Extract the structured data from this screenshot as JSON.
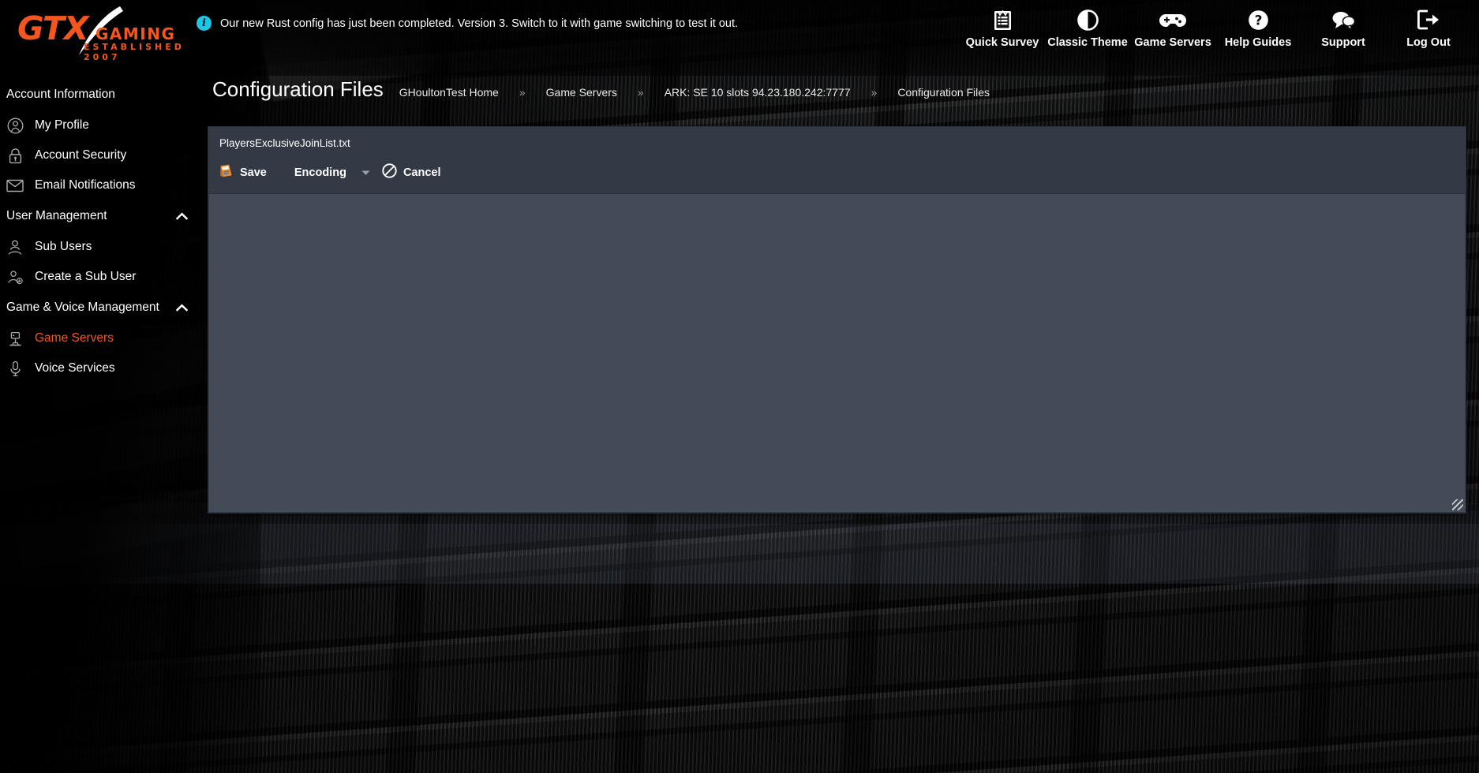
{
  "brand": {
    "name_primary": "GTX",
    "name_secondary": "GAMING",
    "tagline": "ESTABLISHED 2007",
    "accent_color": "#f4561d"
  },
  "notice": {
    "icon": "info-circle-icon",
    "text": "Our new Rust config has just been completed. Version 3. Switch to it with game switching to test it out.",
    "icon_color": "#19c8e6"
  },
  "topnav": {
    "items": [
      {
        "label": "Quick Survey",
        "icon": "clipboard-survey-icon"
      },
      {
        "label": "Classic Theme",
        "icon": "contrast-circle-icon"
      },
      {
        "label": "Game Servers",
        "icon": "gamepad-icon"
      },
      {
        "label": "Help Guides",
        "icon": "question-circle-icon"
      },
      {
        "label": "Support",
        "icon": "chat-bubbles-icon"
      },
      {
        "label": "Log Out",
        "icon": "logout-arrow-icon"
      }
    ]
  },
  "sidebar": {
    "sections": [
      {
        "title": "Account Information",
        "collapsible": false,
        "chevron": "",
        "items": [
          {
            "label": "My Profile",
            "icon": "user-circle-icon",
            "active": false
          },
          {
            "label": "Account Security",
            "icon": "lock-icon",
            "active": false
          },
          {
            "label": "Email Notifications",
            "icon": "envelope-icon",
            "active": false
          }
        ]
      },
      {
        "title": "User Management",
        "collapsible": true,
        "chevron": "chevron-up-icon",
        "items": [
          {
            "label": "Sub Users",
            "icon": "users-icon",
            "active": false
          },
          {
            "label": "Create a Sub User",
            "icon": "user-add-icon",
            "active": false
          }
        ]
      },
      {
        "title": "Game & Voice Management",
        "collapsible": true,
        "chevron": "chevron-up-icon",
        "items": [
          {
            "label": "Game Servers",
            "icon": "server-rack-icon",
            "active": true
          },
          {
            "label": "Voice Services",
            "icon": "microphone-icon",
            "active": false
          }
        ]
      }
    ],
    "active_color": "#f4561d"
  },
  "page": {
    "title": "Configuration Files",
    "breadcrumb": [
      "GHoultonTest Home",
      "Game Servers",
      "ARK: SE 10 slots 94.23.180.242:7777",
      "Configuration Files"
    ],
    "breadcrumb_separator": "»"
  },
  "editor": {
    "filename": "PlayersExclusiveJoinList.txt",
    "toolbar": {
      "save_label": "Save",
      "save_icon": "save-disk-icon",
      "encoding_label": "Encoding",
      "encoding_caret": "caret-down-icon",
      "cancel_label": "Cancel",
      "cancel_icon": "no-entry-circle-icon"
    },
    "content": "",
    "placeholder": "",
    "background_color": "#434b58",
    "header_color": "#333a45",
    "resize_handle": "resize-grip-icon"
  }
}
